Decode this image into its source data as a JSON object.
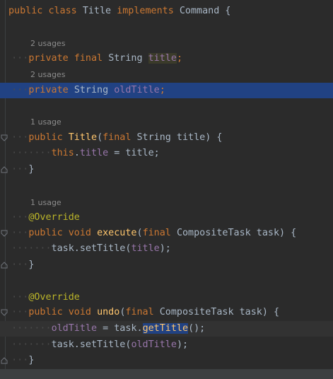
{
  "lines": {
    "l1": {
      "kw1": "public",
      "kw2": "class",
      "name": "Title",
      "kw3": "implements",
      "iface": "Command",
      "brace": "{"
    },
    "h1": "2 usages",
    "l2": {
      "kw1": "private",
      "kw2": "final",
      "type": "String",
      "field": "title",
      "semi": ";"
    },
    "h2": "2 usages",
    "l3": {
      "kw1": "private",
      "type": "String",
      "field": "oldTitle",
      "semi": ";"
    },
    "h3": "1 usage",
    "l4": {
      "kw1": "public",
      "name": "Title",
      "kw2": "final",
      "params": "String title) {"
    },
    "l5": {
      "kw1": "this",
      "dot": ".",
      "field": "title",
      "rest": " = title;"
    },
    "l6": "}",
    "h4": "1 usage",
    "l7": "@Override",
    "l8": {
      "kw1": "public",
      "kw2": "void",
      "name": "execute",
      "kw3": "final",
      "params": "CompositeTask task) {"
    },
    "l9": {
      "pre": "task.setTitle(",
      "field": "title",
      "post": ");"
    },
    "l10": "}",
    "l11": "@Override",
    "l12": {
      "kw1": "public",
      "kw2": "void",
      "name": "undo",
      "kw3": "final",
      "params": "CompositeTask task) {"
    },
    "l13": {
      "field": "oldTitle",
      "mid": " = task.",
      "call": "getTitle",
      "post": "();"
    },
    "l14": {
      "pre": "task.setTitle(",
      "field": "oldTitle",
      "post": ");"
    },
    "l15": "}"
  },
  "colors": {
    "background": "#2b2b2b",
    "keyword": "#cc7832",
    "field": "#9876aa",
    "method": "#ffc66d",
    "annotation": "#bbb529",
    "selection": "#214283"
  },
  "icons": [
    "fold-start-icon",
    "fold-end-icon"
  ]
}
